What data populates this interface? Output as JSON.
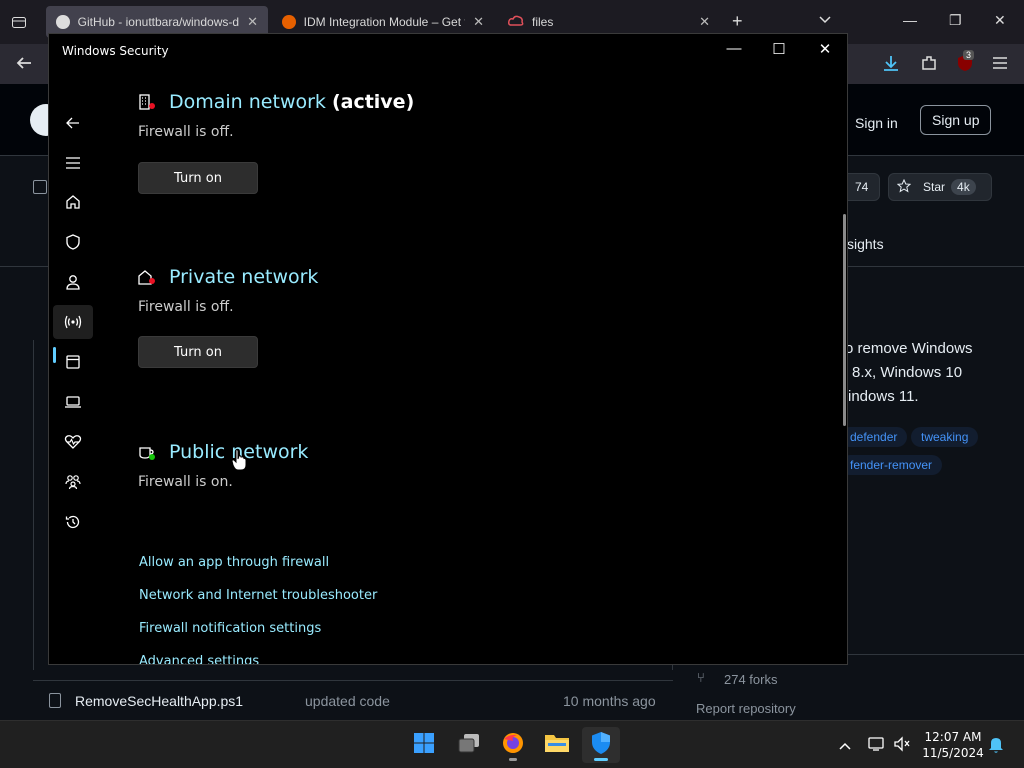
{
  "browser": {
    "tabs": [
      {
        "label": "GitHub - ionuttbara/windows-d"
      },
      {
        "label": "IDM Integration Module – Get t"
      },
      {
        "label": "files"
      }
    ],
    "extension_badge": "3"
  },
  "github": {
    "sign_in": "Sign in",
    "sign_up": "Sign up",
    "count_partial": "74",
    "star_label": "Star",
    "star_count": "4k",
    "tab_partial": "sights",
    "about_lines": [
      "o remove Windows",
      "8.x, Windows 10",
      "indows 11."
    ],
    "topics": [
      "defender",
      "tweaking",
      "fender-remover"
    ],
    "file_row": {
      "name": "RemoveSecHealthApp.ps1",
      "message": "updated code",
      "date": "10 months ago"
    },
    "forks": "274 forks",
    "report": "Report repository"
  },
  "window": {
    "title": "Windows Security",
    "networks": [
      {
        "title": "Domain network",
        "badge": "(active)",
        "status": "Firewall is off.",
        "button": "Turn on"
      },
      {
        "title": "Private network",
        "status": "Firewall is off.",
        "button": "Turn on"
      },
      {
        "title": "Public network",
        "status": "Firewall is on."
      }
    ],
    "links": [
      "Allow an app through firewall",
      "Network and Internet troubleshooter",
      "Firewall notification settings",
      "Advanced settings"
    ],
    "nav_icons": [
      "back-icon",
      "menu-icon",
      "home-icon",
      "shield-icon",
      "person-icon",
      "network-icon",
      "app-browser-icon",
      "laptop-icon",
      "heart-icon",
      "family-icon",
      "history-icon",
      "settings-icon"
    ],
    "accent": "#99ebff"
  },
  "taskbar": {
    "time": "12:07 AM",
    "date": "11/5/2024"
  }
}
